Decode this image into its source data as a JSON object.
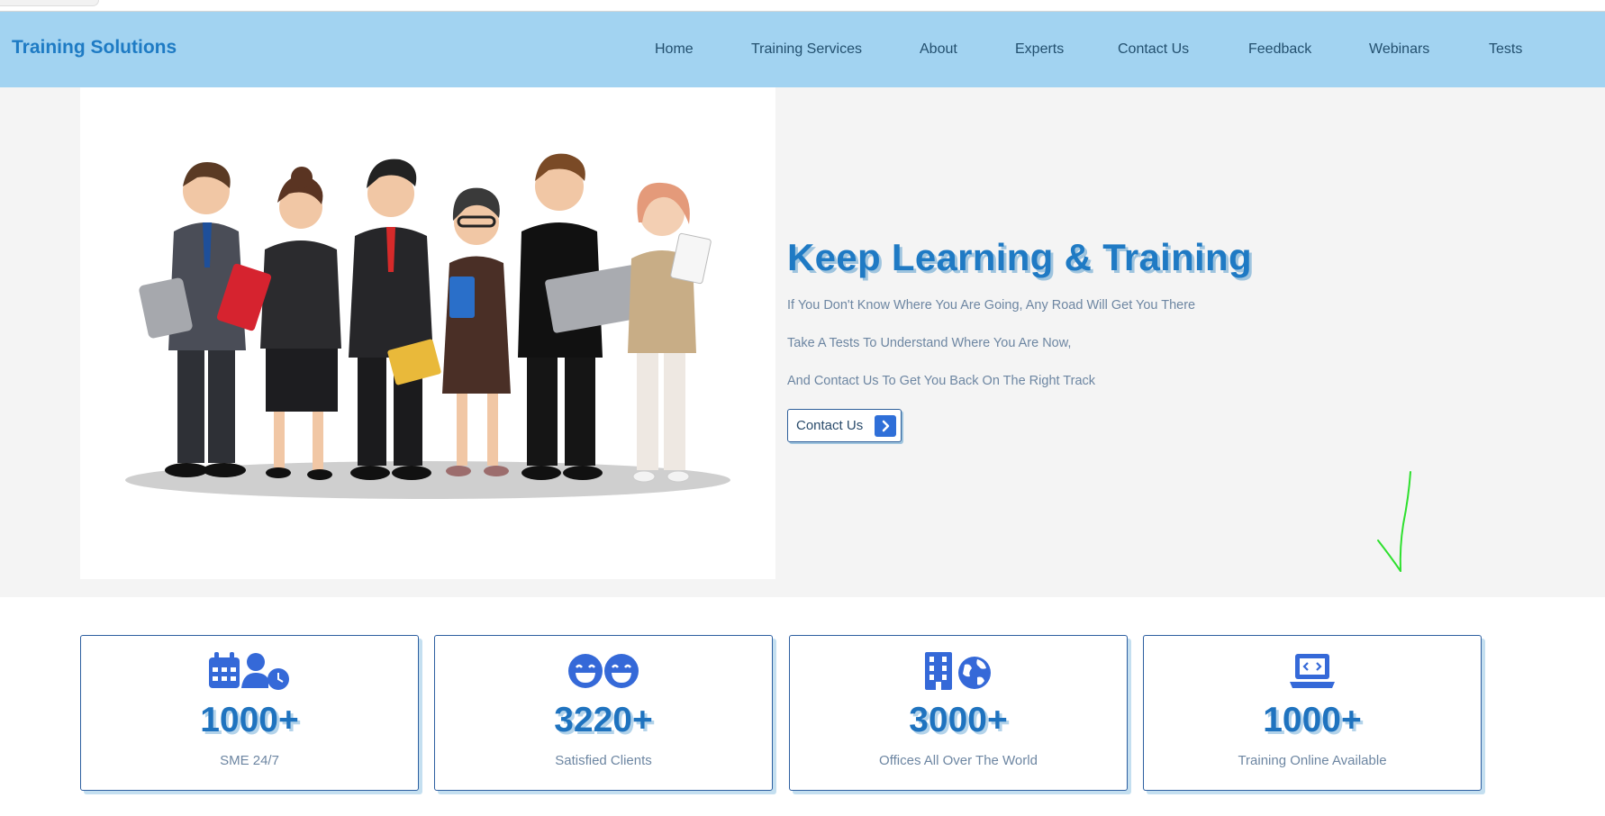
{
  "header": {
    "brand": "Training Solutions",
    "nav": [
      "Home",
      "Training Services",
      "About",
      "Experts",
      "Contact Us",
      "Feedback",
      "Webinars",
      "Tests"
    ]
  },
  "hero": {
    "title": "Keep Learning & Training",
    "lines": [
      "If You Don't Know Where You Are Going, Any Road Will Get You There",
      "Take A Tests To Understand Where You Are Now,",
      "And Contact Us To Get You Back On The Right Track"
    ],
    "button_label": "Contact Us"
  },
  "stats": [
    {
      "icon": "calendar-user-clock-icon",
      "value": "1000+",
      "label": "SME 24/7"
    },
    {
      "icon": "grinning-faces-icon",
      "value": "3220+",
      "label": "Satisfied Clients"
    },
    {
      "icon": "building-globe-icon",
      "value": "3000+",
      "label": "Offices All Over The World"
    },
    {
      "icon": "laptop-code-icon",
      "value": "1000+",
      "label": "Training Online Available"
    }
  ],
  "colors": {
    "header_bg": "#a2d3f1",
    "brand": "#1e7bc4",
    "accent": "#2f6fd8",
    "annotation": "#2ee02e"
  }
}
